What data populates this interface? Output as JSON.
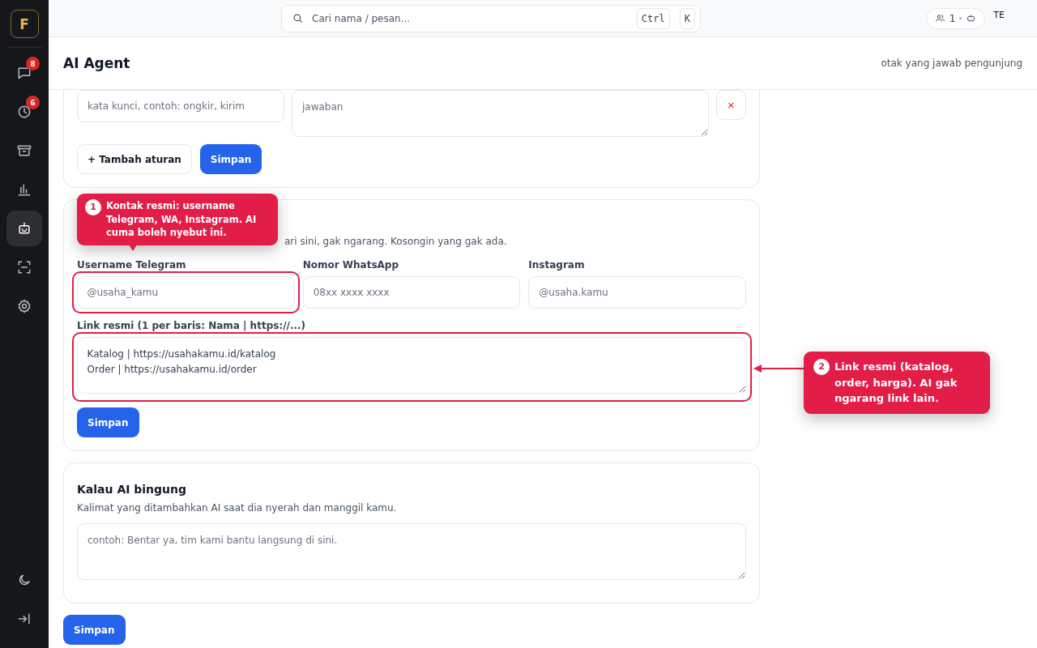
{
  "sidebar": {
    "logo": "F",
    "items": [
      {
        "kind": "chat",
        "badge": "8",
        "selected": false
      },
      {
        "kind": "clock",
        "badge": "6",
        "selected": false
      },
      {
        "kind": "archive",
        "selected": false
      },
      {
        "kind": "chart",
        "selected": false
      },
      {
        "kind": "robot",
        "selected": true
      },
      {
        "kind": "scan",
        "selected": false
      },
      {
        "kind": "gear",
        "selected": false
      }
    ],
    "bottom": [
      {
        "kind": "moon"
      },
      {
        "kind": "collapse"
      }
    ]
  },
  "topbar": {
    "search": {
      "placeholder": "Cari nama / pesan...",
      "keys": [
        "Ctrl",
        "K"
      ]
    },
    "presence": {
      "count": "1"
    },
    "user": "TE"
  },
  "header": {
    "title": "AI Agent",
    "subtitle": "otak yang jawab pengunjung"
  },
  "rules_card": {
    "rule": {
      "keyword_placeholder": "kata kunci, contoh: ongkir, kirim",
      "answer_placeholder": "jawaban",
      "remove": "×"
    },
    "add_button": "+ Tambah aturan",
    "save_button": "Simpan"
  },
  "contacts_card": {
    "description": "ari sini, gak ngarang. Kosongin yang gak ada.",
    "fields": [
      {
        "label": "Username Telegram",
        "placeholder": "@usaha_kamu",
        "highlighted": true
      },
      {
        "label": "Nomor WhatsApp",
        "placeholder": "08xx xxxx xxxx",
        "highlighted": false
      },
      {
        "label": "Instagram",
        "placeholder": "@usaha.kamu",
        "highlighted": false
      }
    ],
    "links": {
      "label": "Link resmi (1 per baris: Nama | https://...)",
      "value": "Katalog | https://usahakamu.id/katalog\nOrder | https://usahakamu.id/order",
      "highlighted": true
    },
    "save_button": "Simpan"
  },
  "fallback_card": {
    "title": "Kalau AI bingung",
    "description": "Kalimat yang ditambahkan AI saat dia nyerah dan manggil kamu.",
    "placeholder": "contoh: Bentar ya, tim kami bantu langsung di sini."
  },
  "save_button": "Simpan",
  "callouts": [
    {
      "number": "1",
      "text": "Kontak resmi: username Telegram, WA, Instagram. AI cuma boleh nyebut ini."
    },
    {
      "number": "2",
      "text": "Link resmi (katalog, order, harga). AI gak ngarang link lain."
    }
  ]
}
